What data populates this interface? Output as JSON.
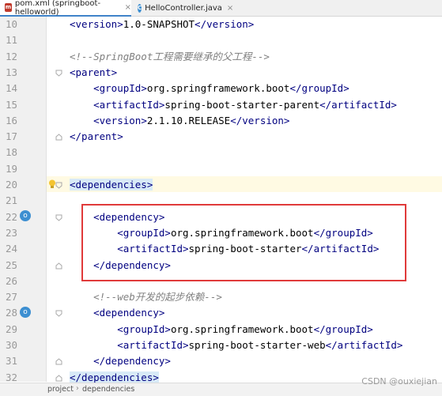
{
  "tabs": [
    {
      "icon": "m",
      "label": "pom.xml (springboot-helloworld)"
    },
    {
      "icon": "c",
      "label": "HelloController.java"
    }
  ],
  "lines": [
    {
      "n": "10",
      "indent": "",
      "parts": [
        [
          "tag",
          "<version>"
        ],
        [
          "txt",
          "1.0-SNAPSHOT"
        ],
        [
          "tag",
          "</version>"
        ]
      ]
    },
    {
      "n": "11",
      "indent": "",
      "parts": []
    },
    {
      "n": "12",
      "indent": "",
      "parts": [
        [
          "cmt",
          "<!--SpringBoot工程需要继承的父工程-->"
        ]
      ]
    },
    {
      "n": "13",
      "indent": "",
      "parts": [
        [
          "tag",
          "<parent>"
        ]
      ]
    },
    {
      "n": "14",
      "indent": "    ",
      "parts": [
        [
          "tag",
          "<groupId>"
        ],
        [
          "txt",
          "org.springframework.boot"
        ],
        [
          "tag",
          "</groupId>"
        ]
      ]
    },
    {
      "n": "15",
      "indent": "    ",
      "parts": [
        [
          "tag",
          "<artifactId>"
        ],
        [
          "txt",
          "spring-boot-starter-parent"
        ],
        [
          "tag",
          "</artifactId>"
        ]
      ]
    },
    {
      "n": "16",
      "indent": "    ",
      "parts": [
        [
          "tag",
          "<version>"
        ],
        [
          "txt",
          "2.1.10.RELEASE"
        ],
        [
          "tag",
          "</version>"
        ]
      ]
    },
    {
      "n": "17",
      "indent": "",
      "parts": [
        [
          "tag",
          "</parent>"
        ]
      ]
    },
    {
      "n": "18",
      "indent": "",
      "parts": []
    },
    {
      "n": "19",
      "indent": "",
      "parts": []
    },
    {
      "n": "20",
      "indent": "",
      "parts": [
        [
          "match",
          "<dependencies>"
        ]
      ]
    },
    {
      "n": "21",
      "indent": "",
      "parts": []
    },
    {
      "n": "22",
      "indent": "    ",
      "parts": [
        [
          "tag",
          "<dependency>"
        ]
      ]
    },
    {
      "n": "23",
      "indent": "        ",
      "parts": [
        [
          "tag",
          "<groupId>"
        ],
        [
          "txt",
          "org.springframework.boot"
        ],
        [
          "tag",
          "</groupId>"
        ]
      ]
    },
    {
      "n": "24",
      "indent": "        ",
      "parts": [
        [
          "tag",
          "<artifactId>"
        ],
        [
          "txt",
          "spring-boot-starter"
        ],
        [
          "tag",
          "</artifactId>"
        ]
      ]
    },
    {
      "n": "25",
      "indent": "    ",
      "parts": [
        [
          "tag",
          "</dependency>"
        ]
      ]
    },
    {
      "n": "26",
      "indent": "",
      "parts": []
    },
    {
      "n": "27",
      "indent": "    ",
      "parts": [
        [
          "cmt",
          "<!--web开发的起步依赖-->"
        ]
      ]
    },
    {
      "n": "28",
      "indent": "    ",
      "parts": [
        [
          "tag",
          "<dependency>"
        ]
      ]
    },
    {
      "n": "29",
      "indent": "        ",
      "parts": [
        [
          "tag",
          "<groupId>"
        ],
        [
          "txt",
          "org.springframework.boot"
        ],
        [
          "tag",
          "</groupId>"
        ]
      ]
    },
    {
      "n": "30",
      "indent": "        ",
      "parts": [
        [
          "tag",
          "<artifactId>"
        ],
        [
          "txt",
          "spring-boot-starter-web"
        ],
        [
          "tag",
          "</artifactId>"
        ]
      ]
    },
    {
      "n": "31",
      "indent": "    ",
      "parts": [
        [
          "tag",
          "</dependency>"
        ]
      ]
    },
    {
      "n": "32",
      "indent": "",
      "parts": [
        [
          "match",
          "</dependencies>"
        ]
      ]
    }
  ],
  "status": {
    "crumb1": "project",
    "crumb2": "dependencies"
  },
  "watermark": "CSDN @ouxiejian",
  "colors": {
    "tag": "#000080",
    "comment": "#808080",
    "highlight": "#d8eaf7",
    "annotation": "#e03a3a"
  }
}
